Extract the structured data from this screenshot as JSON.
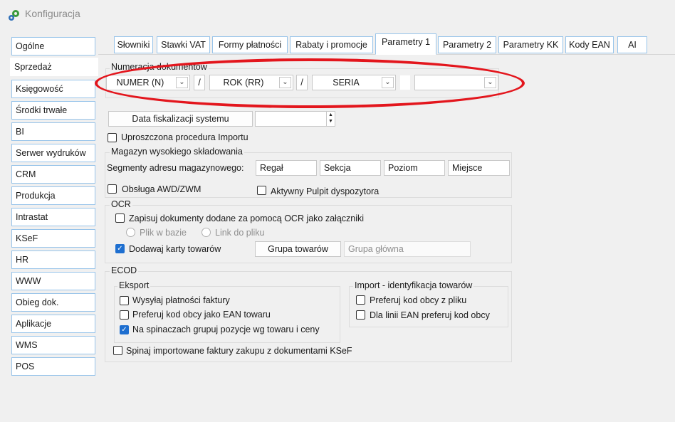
{
  "window": {
    "title": "Konfiguracja",
    "icon": "gears-icon"
  },
  "sidebar": {
    "items": [
      {
        "label": "Ogólne",
        "active": false
      },
      {
        "label": "Sprzedaż",
        "active": true
      },
      {
        "label": "Księgowość",
        "active": false
      },
      {
        "label": "Środki trwałe",
        "active": false
      },
      {
        "label": "BI",
        "active": false
      },
      {
        "label": "Serwer wydruków",
        "active": false
      },
      {
        "label": "CRM",
        "active": false
      },
      {
        "label": "Produkcja",
        "active": false
      },
      {
        "label": "Intrastat",
        "active": false
      },
      {
        "label": "KSeF",
        "active": false
      },
      {
        "label": "HR",
        "active": false
      },
      {
        "label": "WWW",
        "active": false
      },
      {
        "label": "Obieg dok.",
        "active": false
      },
      {
        "label": "Aplikacje",
        "active": false
      },
      {
        "label": "WMS",
        "active": false
      },
      {
        "label": "POS",
        "active": false
      }
    ]
  },
  "tabs": [
    {
      "label": "Słowniki",
      "active": false
    },
    {
      "label": "Stawki VAT",
      "active": false
    },
    {
      "label": "Formy płatności",
      "active": false
    },
    {
      "label": "Rabaty i promocje",
      "active": false
    },
    {
      "label": "Parametry 1",
      "active": true
    },
    {
      "label": "Parametry 2",
      "active": false
    },
    {
      "label": "Parametry KK",
      "active": false
    },
    {
      "label": "Kody EAN",
      "active": false
    },
    {
      "label": "AI",
      "active": false
    }
  ],
  "numeracja": {
    "legend": "Numeracja dokumentów",
    "segment1": "NUMER (N)",
    "separator1": "/",
    "segment2": "ROK (RR)",
    "separator2": "/",
    "segment3": "SERIA",
    "separator3": "",
    "segment4": ""
  },
  "fiskalizacja": {
    "button_label": "Data fiskalizacji systemu",
    "date_value": ""
  },
  "uproszczona": {
    "label": "Uproszczona procedura Importu",
    "checked": false
  },
  "magazyn": {
    "legend": "Magazyn wysokiego składowania",
    "segments_label": "Segmenty adresu magazynowego:",
    "segments": [
      "Regał",
      "Sekcja",
      "Poziom",
      "Miejsce"
    ],
    "awd": {
      "label": "Obsługa AWD/ZWM",
      "checked": false
    },
    "pulpit": {
      "label": "Aktywny Pulpit dyspozytora",
      "checked": false
    }
  },
  "ocr": {
    "legend": "OCR",
    "zapisuj": {
      "label": "Zapisuj dokumenty dodane za pomocą OCR jako załączniki",
      "checked": false
    },
    "plik_w_bazie": "Plik w bazie",
    "link_do_pliku": "Link do pliku",
    "dodawaj": {
      "label": "Dodawaj karty towarów",
      "checked": true
    },
    "grupa_button": "Grupa towarów",
    "grupa_value": "Grupa główna"
  },
  "ecod": {
    "legend": "ECOD",
    "eksport": {
      "legend": "Eksport",
      "options": [
        {
          "label": "Wysyłaj płatności faktury",
          "checked": false
        },
        {
          "label": "Preferuj kod obcy jako EAN towaru",
          "checked": false
        },
        {
          "label": "Na spinaczach grupuj pozycje wg towaru i ceny",
          "checked": true
        }
      ]
    },
    "import": {
      "legend": "Import - identyfikacja towarów",
      "options": [
        {
          "label": "Preferuj kod obcy z pliku",
          "checked": false
        },
        {
          "label": "Dla linii EAN preferuj kod obcy",
          "checked": false
        }
      ]
    },
    "spinaj": {
      "label": "Spinaj importowane faktury zakupu z dokumentami KSeF",
      "checked": false
    }
  },
  "colors": {
    "accent": "#1e6fd0",
    "tab_border": "#98c4ea",
    "highlight": "#e3161d"
  }
}
